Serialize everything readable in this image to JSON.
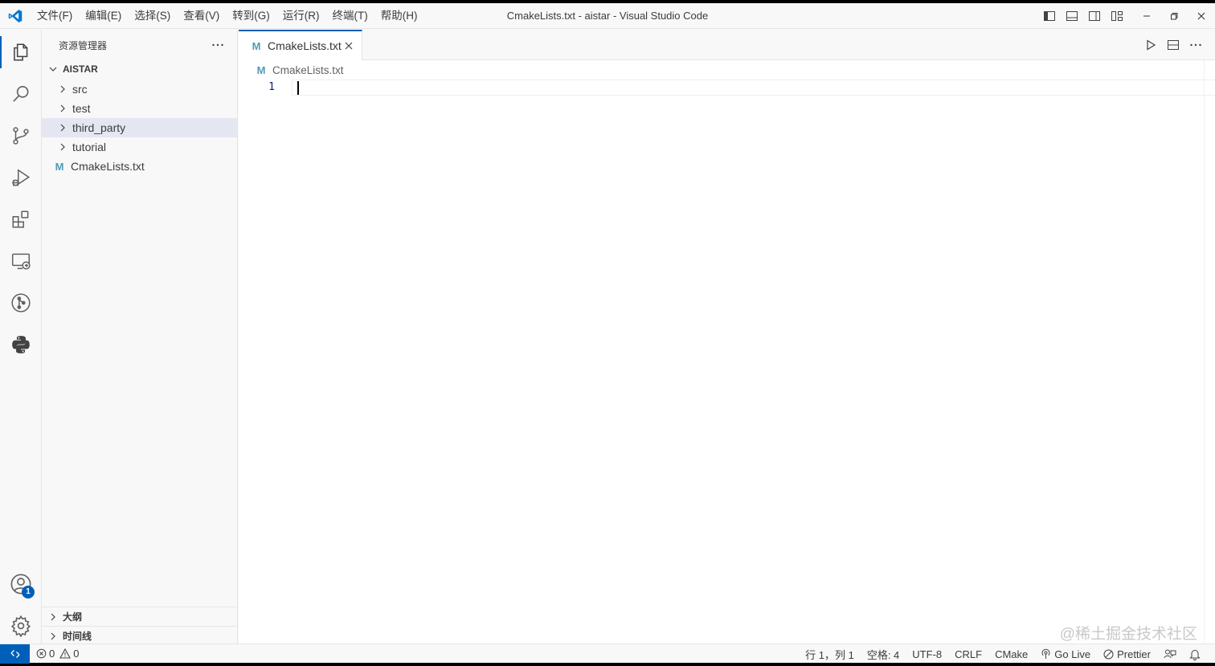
{
  "window": {
    "title": "CmakeLists.txt - aistar - Visual Studio Code"
  },
  "menu": [
    {
      "label": "文件(F)"
    },
    {
      "label": "编辑(E)"
    },
    {
      "label": "选择(S)"
    },
    {
      "label": "查看(V)"
    },
    {
      "label": "转到(G)"
    },
    {
      "label": "运行(R)"
    },
    {
      "label": "终端(T)"
    },
    {
      "label": "帮助(H)"
    }
  ],
  "activity_bar": {
    "items": [
      "explorer-icon",
      "search-icon",
      "source-control-icon",
      "run-debug-icon",
      "extensions-icon",
      "remote-explorer-icon",
      "git-graph-icon",
      "python-icon"
    ],
    "accounts_badge": "1",
    "accent": "#005fb8"
  },
  "sidebar": {
    "title": "资源管理器",
    "workspace": "AISTAR",
    "tree": [
      {
        "label": "src",
        "type": "folder"
      },
      {
        "label": "test",
        "type": "folder"
      },
      {
        "label": "third_party",
        "type": "folder",
        "selected": true
      },
      {
        "label": "tutorial",
        "type": "folder"
      },
      {
        "label": "CmakeLists.txt",
        "type": "file",
        "icon": "M"
      }
    ],
    "outline_label": "大纲",
    "timeline_label": "时间线"
  },
  "editor": {
    "tab_label": "CmakeLists.txt",
    "tab_icon": "M",
    "breadcrumb": "CmakeLists.txt",
    "line_number": "1"
  },
  "status_bar": {
    "errors": "0",
    "warnings": "0",
    "position": "行 1，列 1",
    "spaces": "空格: 4",
    "encoding": "UTF-8",
    "eol": "CRLF",
    "language": "CMake",
    "go_live": "Go Live",
    "prettier": "Prettier"
  },
  "watermark": "@稀土掘金技术社区"
}
